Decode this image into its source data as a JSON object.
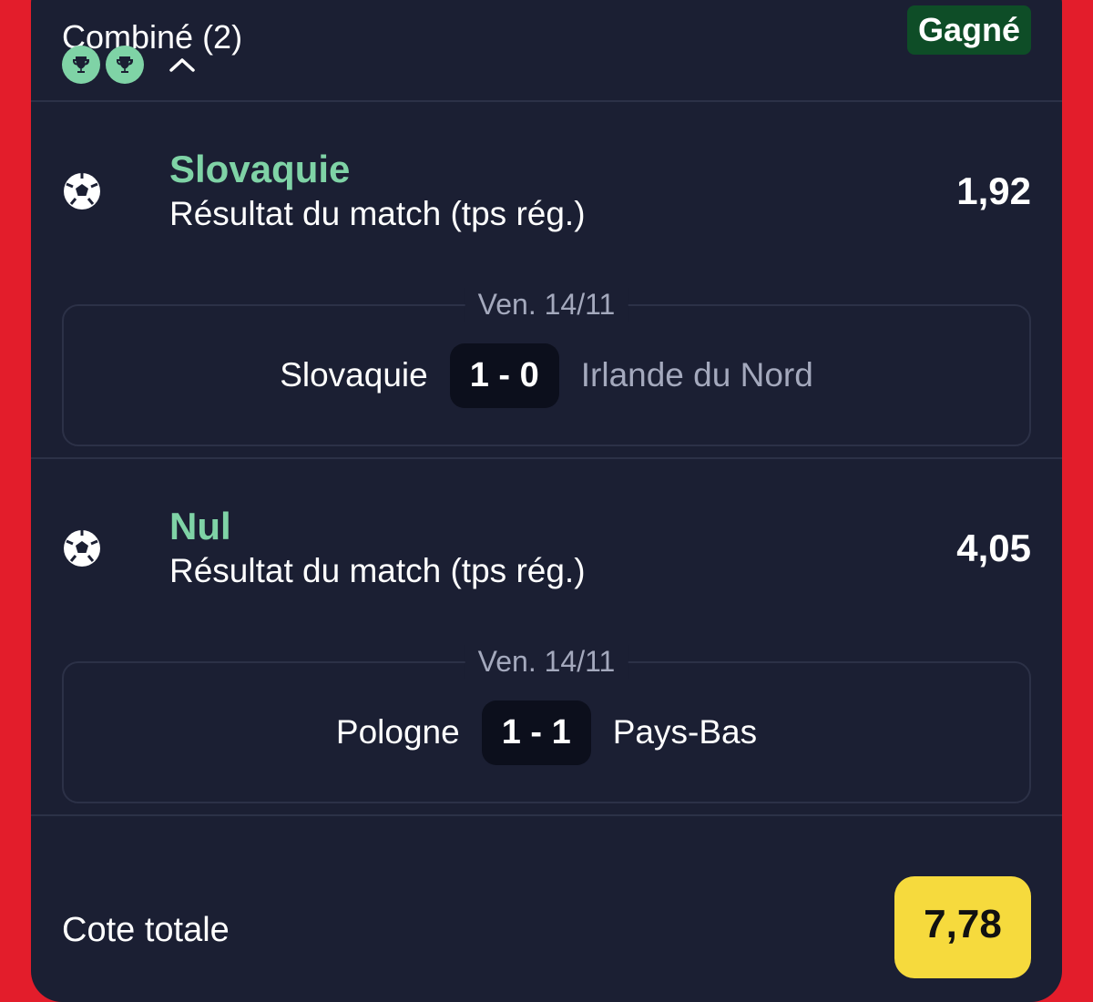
{
  "header": {
    "title": "Combiné (2)",
    "status": "Gagné",
    "trophy_icons": [
      "trophy-icon",
      "trophy-icon"
    ],
    "toggle_icon": "chevron-up-icon"
  },
  "selections": [
    {
      "pick": "Slovaquie",
      "market": "Résultat du match (tps rég.)",
      "odds": "1,92",
      "date": "Ven. 14/11",
      "home_team": "Slovaquie",
      "score": "1 - 0",
      "away_team": "Irlande du Nord",
      "sport_icon": "soccer-ball-icon"
    },
    {
      "pick": "Nul",
      "market": "Résultat du match (tps rég.)",
      "odds": "4,05",
      "date": "Ven. 14/11",
      "home_team": "Pologne",
      "score": "1 - 1",
      "away_team": "Pays-Bas",
      "sport_icon": "soccer-ball-icon"
    }
  ],
  "footer": {
    "total_label": "Cote totale",
    "total_odds": "7,78"
  },
  "colors": {
    "background": "#e31d2b",
    "card": "#1b1f33",
    "accent_green": "#7fd3a6",
    "won_badge": "#0e4d27",
    "total_badge": "#f6da3d"
  }
}
